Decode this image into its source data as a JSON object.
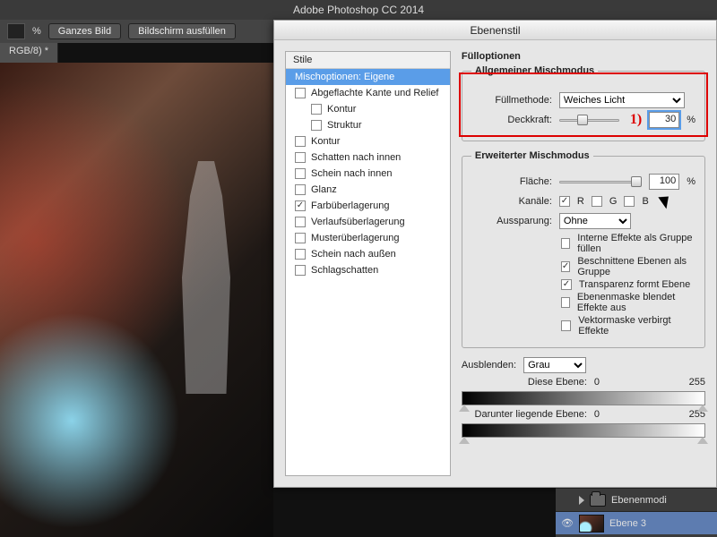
{
  "app": {
    "title": "Adobe Photoshop CC 2014"
  },
  "optionbar": {
    "pct_suffix": "%",
    "btn_fit": "Ganzes Bild",
    "btn_fill": "Bildschirm ausfüllen"
  },
  "doc_tab": "RGB/8) *",
  "dialog": {
    "title": "Ebenenstil",
    "styles_header": "Stile",
    "styles": [
      {
        "label": "Mischoptionen: Eigene",
        "checked": null,
        "selected": true
      },
      {
        "label": "Abgeflachte Kante und Relief",
        "checked": false
      },
      {
        "label": "Kontur",
        "checked": false,
        "indent": true
      },
      {
        "label": "Struktur",
        "checked": false,
        "indent": true
      },
      {
        "label": "Kontur",
        "checked": false
      },
      {
        "label": "Schatten nach innen",
        "checked": false
      },
      {
        "label": "Schein nach innen",
        "checked": false
      },
      {
        "label": "Glanz",
        "checked": false
      },
      {
        "label": "Farbüberlagerung",
        "checked": true
      },
      {
        "label": "Verlaufsüberlagerung",
        "checked": false
      },
      {
        "label": "Musterüberlagerung",
        "checked": false
      },
      {
        "label": "Schein nach außen",
        "checked": false
      },
      {
        "label": "Schlagschatten",
        "checked": false
      }
    ],
    "section_title": "Füllоptionen",
    "general": {
      "legend": "Allgemeiner Mischmodus",
      "blendmode_label": "Füllmethode:",
      "blendmode_value": "Weiches Licht",
      "opacity_label": "Deckkraft:",
      "opacity_value": "30",
      "opacity_suffix": "%",
      "annotation": "1)"
    },
    "advanced": {
      "legend": "Erweiterter Mischmodus",
      "fill_label": "Fläche:",
      "fill_value": "100",
      "fill_suffix": "%",
      "channels_label": "Kanäle:",
      "ch_r": "R",
      "ch_g": "G",
      "ch_b": "B",
      "knockout_label": "Aussparung:",
      "knockout_value": "Ohne",
      "opts": [
        {
          "label": "Interne Effekte als Gruppe füllen",
          "checked": false
        },
        {
          "label": "Beschnittene Ebenen als Gruppe",
          "checked": true
        },
        {
          "label": "Transparenz formt Ebene",
          "checked": true
        },
        {
          "label": "Ebenenmaske blendet Effekte aus",
          "checked": false
        },
        {
          "label": "Vektormaske verbirgt Effekte",
          "checked": false
        }
      ]
    },
    "blendif": {
      "label": "Ausblenden:",
      "value": "Grau",
      "this_label": "Diese Ebene:",
      "this_lo": "0",
      "this_hi": "255",
      "under_label": "Darunter liegende Ebene:",
      "under_lo": "0",
      "under_hi": "255"
    }
  },
  "layers": {
    "group_name": "Ebenenmodi",
    "layer_name": "Ebene 3"
  }
}
